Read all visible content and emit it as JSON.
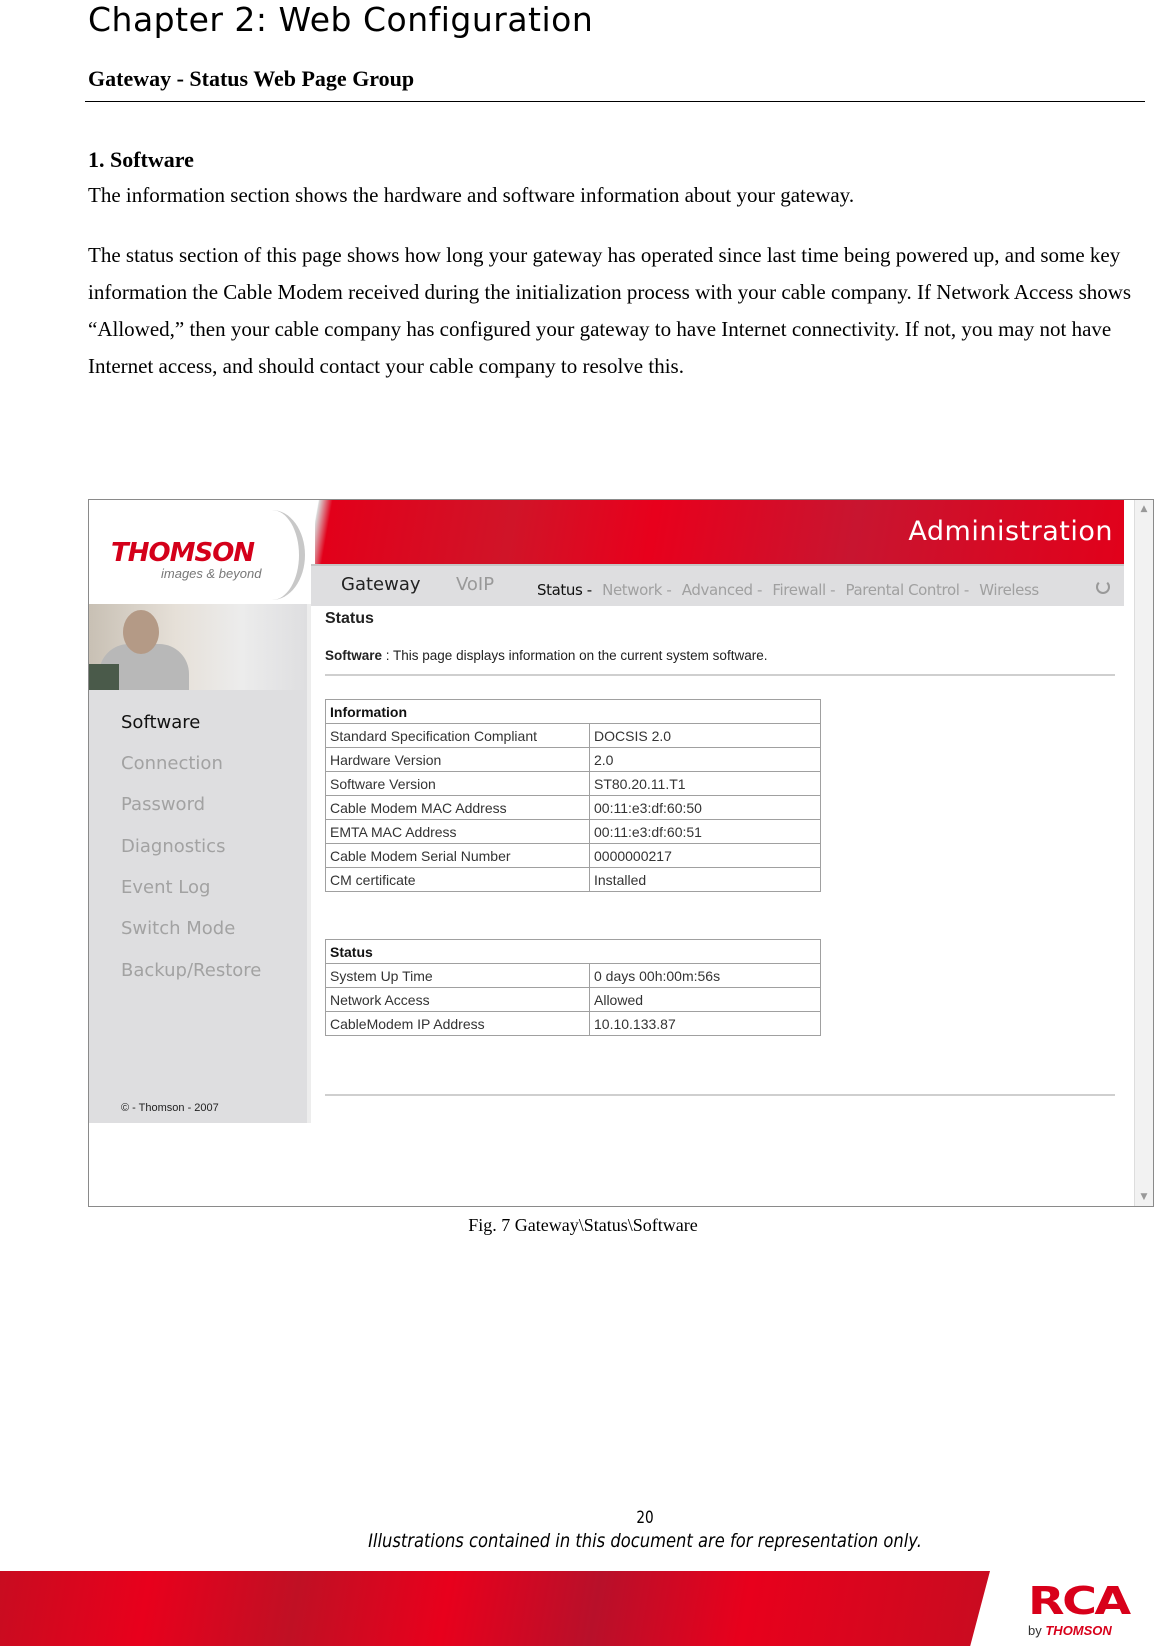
{
  "document": {
    "chapter_title": "Chapter 2: Web Configuration",
    "section_heading": "Gateway - Status Web Page Group",
    "sub_heading": "1. Software",
    "para1": "The information section shows the hardware and software information about your gateway.",
    "para2": "The status section of this page shows how long your gateway has operated since last time being powered up, and some key information the Cable Modem received during the initialization process with your cable company. If Network Access shows “Allowed,” then your cable company has configured your gateway to have Internet connectivity. If not, you may not have Internet access, and should contact your cable company to resolve this.",
    "figure_caption": "Fig. 7 Gateway\\Status\\Software",
    "page_number": "20",
    "disclaimer": "Illustrations contained in this document are for representation only."
  },
  "screenshot": {
    "logo": {
      "brand": "THOMSON",
      "tagline": "images & beyond"
    },
    "banner_title": "Administration",
    "main_nav": [
      {
        "label": "Gateway",
        "active": true
      },
      {
        "label": "VoIP",
        "active": false
      }
    ],
    "sub_nav": [
      {
        "label": "Status -",
        "active": true
      },
      {
        "label": "Network -",
        "active": false
      },
      {
        "label": "Advanced -",
        "active": false
      },
      {
        "label": "Firewall -",
        "active": false
      },
      {
        "label": "Parental Control -",
        "active": false
      },
      {
        "label": "Wireless",
        "active": false
      }
    ],
    "sidebar": {
      "items": [
        {
          "label": "Software",
          "active": true
        },
        {
          "label": "Connection",
          "active": false
        },
        {
          "label": "Password",
          "active": false
        },
        {
          "label": "Diagnostics",
          "active": false
        },
        {
          "label": "Event Log",
          "active": false
        },
        {
          "label": "Switch Mode",
          "active": false
        },
        {
          "label": "Backup/Restore",
          "active": false
        }
      ],
      "copyright": "© - Thomson - 2007"
    },
    "content": {
      "title": "Status",
      "desc_label": "Software",
      "desc_sep": " : ",
      "desc_text": "This page displays information on the current system software.",
      "information_table": {
        "header": "Information",
        "rows": [
          {
            "label": "Standard Specification Compliant",
            "value": "DOCSIS 2.0"
          },
          {
            "label": "Hardware Version",
            "value": "2.0"
          },
          {
            "label": "Software Version",
            "value": "ST80.20.11.T1"
          },
          {
            "label": "Cable Modem MAC Address",
            "value": "00:11:e3:df:60:50"
          },
          {
            "label": "EMTA MAC Address",
            "value": "00:11:e3:df:60:51"
          },
          {
            "label": "Cable Modem Serial Number",
            "value": "0000000217"
          },
          {
            "label": "CM certificate",
            "value": "Installed"
          }
        ]
      },
      "status_table": {
        "header": "Status",
        "rows": [
          {
            "label": "System Up Time",
            "value": "0 days 00h:00m:56s"
          },
          {
            "label": "Network Access",
            "value": "Allowed"
          },
          {
            "label": "CableModem IP Address",
            "value": "10.10.133.87"
          }
        ]
      }
    }
  },
  "footer": {
    "rca_logo": "RCA",
    "rca_by": "by",
    "rca_brand": "THOMSON"
  },
  "colors": {
    "brand_red": "#e2001a",
    "nav_bg": "#dedee0",
    "inactive_text": "#a0a0a0"
  }
}
